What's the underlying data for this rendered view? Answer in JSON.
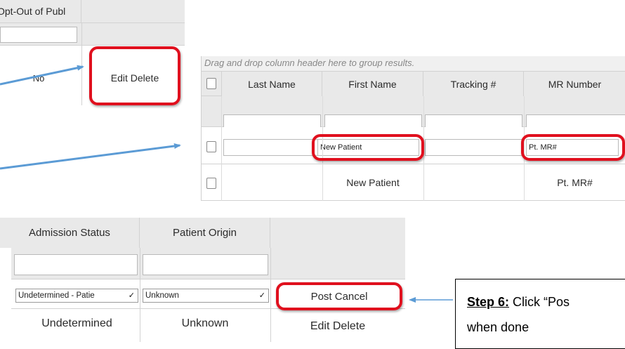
{
  "top_grid": {
    "header_opt_out": "Opt-Out of Publ",
    "value_opt_out": "No",
    "actions": "Edit Delete"
  },
  "patient_grid": {
    "group_hint": "Drag and drop column header here to group results.",
    "columns": [
      "Last Name",
      "First Name",
      "Tracking #",
      "MR Number"
    ],
    "edit_row": {
      "first_name": "New Patient",
      "mr_number": "Pt. MR#"
    },
    "data_row": {
      "first_name": "New Patient",
      "mr_number": "Pt. MR#"
    }
  },
  "admission_grid": {
    "columns": [
      "Admission Status",
      "Patient Origin"
    ],
    "edit_row": {
      "admission_status": "Undetermined - Patie",
      "patient_origin": "Unknown",
      "actions": "Post Cancel"
    },
    "data_row": {
      "admission_status": "Undetermined",
      "patient_origin": "Unknown",
      "actions": "Edit Delete"
    }
  },
  "callout": {
    "step_label": "Step 6:",
    "step_text": " Click “Pos",
    "line2": "when done"
  },
  "colors": {
    "highlight": "#e0101e",
    "arrow": "#5b9bd5",
    "header_bg": "#e9e9e9"
  }
}
